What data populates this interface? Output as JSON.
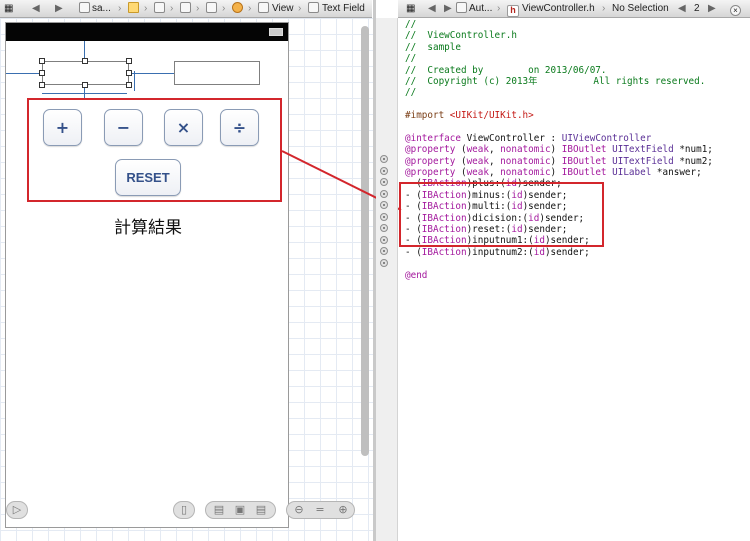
{
  "left_jumpbar": {
    "project": "sa...",
    "view": "View",
    "text_field": "Text Field"
  },
  "right_jumpbar": {
    "auto": "Aut...",
    "file": "ViewController.h",
    "selection": "No Selection",
    "counter": "2"
  },
  "canvas": {
    "buttons": {
      "plus": "+",
      "minus": "−",
      "multi": "×",
      "divide": "÷",
      "reset": "RESET"
    },
    "answer_label": "計算結果"
  },
  "code_lines": [
    [
      {
        "c": "cm",
        "t": "//"
      }
    ],
    [
      {
        "c": "cm",
        "t": "//  ViewController.h"
      }
    ],
    [
      {
        "c": "cm",
        "t": "//  sample"
      }
    ],
    [
      {
        "c": "cm",
        "t": "//"
      }
    ],
    [
      {
        "c": "cm",
        "t": "//  Created by        on 2013/06/07."
      }
    ],
    [
      {
        "c": "cm",
        "t": "//  Copyright (c) 2013年          All rights reserved."
      }
    ],
    [
      {
        "c": "cm",
        "t": "//"
      }
    ],
    [
      {
        "c": "plain",
        "t": ""
      }
    ],
    [
      {
        "c": "pp",
        "t": "#import "
      },
      {
        "c": "str",
        "t": "<UIKit/UIKit.h>"
      }
    ],
    [
      {
        "c": "plain",
        "t": ""
      }
    ],
    [
      {
        "c": "kw",
        "t": "@interface"
      },
      {
        "c": "plain",
        "t": " ViewController : "
      },
      {
        "c": "cls",
        "t": "UIViewController"
      }
    ],
    [
      {
        "c": "kw",
        "t": "@property"
      },
      {
        "c": "plain",
        "t": " ("
      },
      {
        "c": "kw",
        "t": "weak"
      },
      {
        "c": "plain",
        "t": ", "
      },
      {
        "c": "kw",
        "t": "nonatomic"
      },
      {
        "c": "plain",
        "t": ") "
      },
      {
        "c": "kw",
        "t": "IBOutlet"
      },
      {
        "c": "plain",
        "t": " "
      },
      {
        "c": "cls",
        "t": "UITextField"
      },
      {
        "c": "plain",
        "t": " *num1;"
      }
    ],
    [
      {
        "c": "kw",
        "t": "@property"
      },
      {
        "c": "plain",
        "t": " ("
      },
      {
        "c": "kw",
        "t": "weak"
      },
      {
        "c": "plain",
        "t": ", "
      },
      {
        "c": "kw",
        "t": "nonatomic"
      },
      {
        "c": "plain",
        "t": ") "
      },
      {
        "c": "kw",
        "t": "IBOutlet"
      },
      {
        "c": "plain",
        "t": " "
      },
      {
        "c": "cls",
        "t": "UITextField"
      },
      {
        "c": "plain",
        "t": " *num2;"
      }
    ],
    [
      {
        "c": "kw",
        "t": "@property"
      },
      {
        "c": "plain",
        "t": " ("
      },
      {
        "c": "kw",
        "t": "weak"
      },
      {
        "c": "plain",
        "t": ", "
      },
      {
        "c": "kw",
        "t": "nonatomic"
      },
      {
        "c": "plain",
        "t": ") "
      },
      {
        "c": "kw",
        "t": "IBOutlet"
      },
      {
        "c": "plain",
        "t": " "
      },
      {
        "c": "cls",
        "t": "UILabel"
      },
      {
        "c": "plain",
        "t": " *answer;"
      }
    ],
    [
      {
        "c": "plain",
        "t": "- ("
      },
      {
        "c": "kw",
        "t": "IBAction"
      },
      {
        "c": "plain",
        "t": ")plus:("
      },
      {
        "c": "kw",
        "t": "id"
      },
      {
        "c": "plain",
        "t": ")sender;"
      }
    ],
    [
      {
        "c": "plain",
        "t": "- ("
      },
      {
        "c": "kw",
        "t": "IBAction"
      },
      {
        "c": "plain",
        "t": ")minus:("
      },
      {
        "c": "kw",
        "t": "id"
      },
      {
        "c": "plain",
        "t": ")sender;"
      }
    ],
    [
      {
        "c": "plain",
        "t": "- ("
      },
      {
        "c": "kw",
        "t": "IBAction"
      },
      {
        "c": "plain",
        "t": ")multi:("
      },
      {
        "c": "kw",
        "t": "id"
      },
      {
        "c": "plain",
        "t": ")sender;"
      }
    ],
    [
      {
        "c": "plain",
        "t": "- ("
      },
      {
        "c": "kw",
        "t": "IBAction"
      },
      {
        "c": "plain",
        "t": ")dicision:("
      },
      {
        "c": "kw",
        "t": "id"
      },
      {
        "c": "plain",
        "t": ")sender;"
      }
    ],
    [
      {
        "c": "plain",
        "t": "- ("
      },
      {
        "c": "kw",
        "t": "IBAction"
      },
      {
        "c": "plain",
        "t": ")reset:("
      },
      {
        "c": "kw",
        "t": "id"
      },
      {
        "c": "plain",
        "t": ")sender;"
      }
    ],
    [
      {
        "c": "plain",
        "t": "- ("
      },
      {
        "c": "kw",
        "t": "IBAction"
      },
      {
        "c": "plain",
        "t": ")inputnum1:("
      },
      {
        "c": "kw",
        "t": "id"
      },
      {
        "c": "plain",
        "t": ")sender;"
      }
    ],
    [
      {
        "c": "plain",
        "t": "- ("
      },
      {
        "c": "kw",
        "t": "IBAction"
      },
      {
        "c": "plain",
        "t": ")inputnum2:("
      },
      {
        "c": "kw",
        "t": "id"
      },
      {
        "c": "plain",
        "t": ")sender;"
      }
    ],
    [
      {
        "c": "plain",
        "t": ""
      }
    ],
    [
      {
        "c": "kw",
        "t": "@end"
      }
    ]
  ],
  "colors": {
    "highlight": "#d3262c",
    "comment": "#0a7a1c",
    "keyword": "#a3189d",
    "string": "#c41a16",
    "class": "#5a2f96",
    "button_text": "#34518a"
  }
}
